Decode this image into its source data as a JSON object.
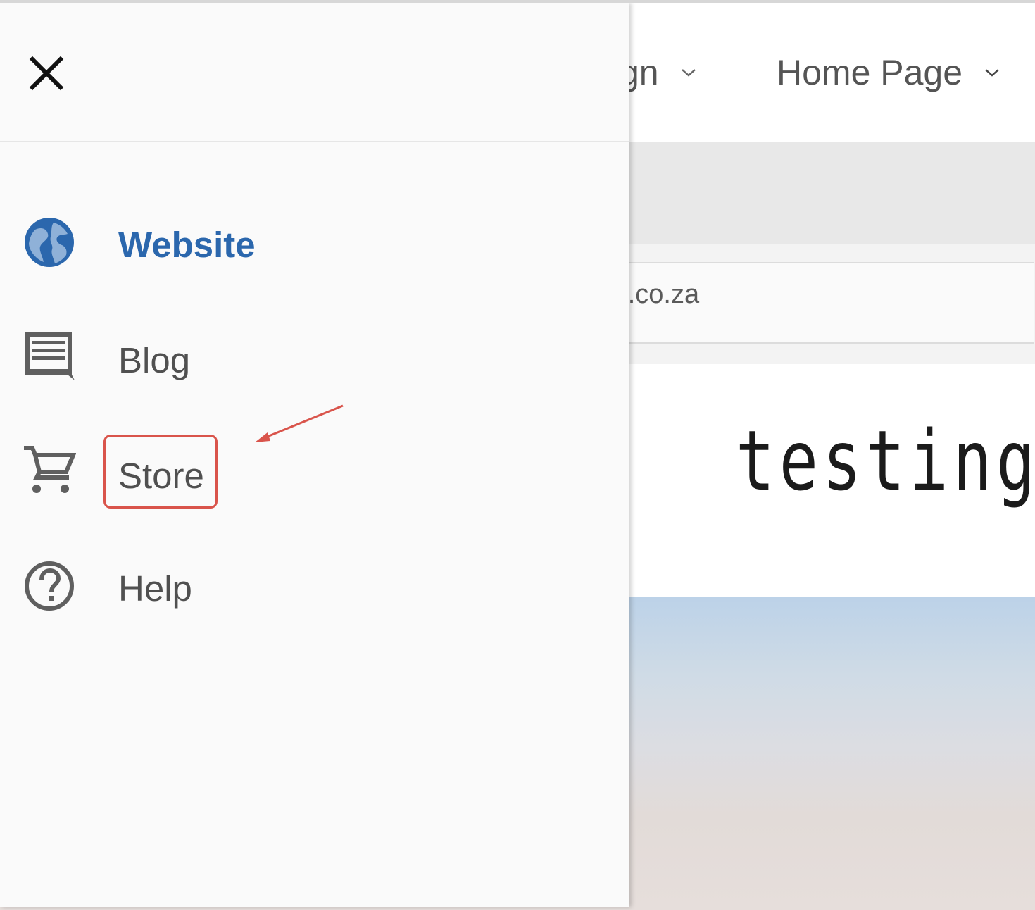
{
  "topbar": {
    "items": [
      {
        "label": "gn"
      },
      {
        "label": "Home Page"
      }
    ]
  },
  "url_bar": {
    "value": "nt.co.za"
  },
  "site": {
    "logo_text": "testing"
  },
  "drawer": {
    "items": [
      {
        "label": "Website",
        "icon": "globe-icon",
        "active": true
      },
      {
        "label": "Blog",
        "icon": "blog-icon",
        "active": false
      },
      {
        "label": "Store",
        "icon": "cart-icon",
        "active": false
      },
      {
        "label": "Help",
        "icon": "help-icon",
        "active": false
      }
    ]
  },
  "colors": {
    "accent": "#2b67ad",
    "annotation": "#d9544b",
    "drawer_bg": "#fafafa",
    "text": "#505050"
  }
}
